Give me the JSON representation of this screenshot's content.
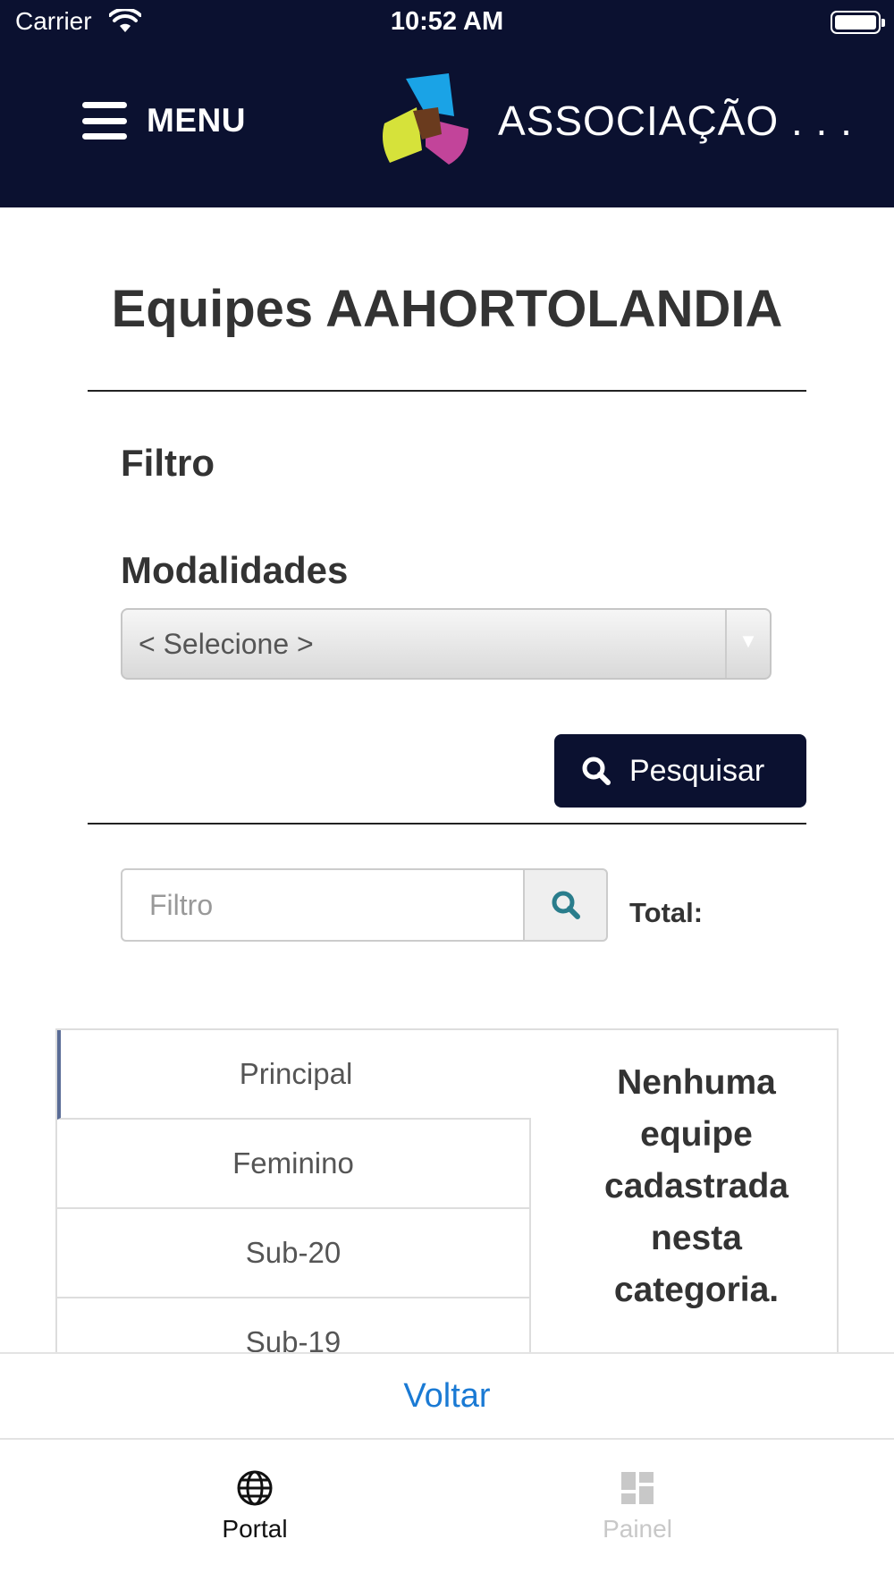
{
  "status_bar": {
    "carrier": "Carrier",
    "time": "10:52 AM"
  },
  "header": {
    "menu_label": "MENU",
    "brand": "ASSOCIAÇÃO . . ."
  },
  "page": {
    "title": "Equipes AAHORTOLANDIA"
  },
  "filter_section": {
    "heading": "Filtro",
    "modalidades_label": "Modalidades",
    "modalidades_selected": "< Selecione >",
    "search_button": "Pesquisar"
  },
  "list_filter": {
    "placeholder": "Filtro",
    "total_label": "Total:"
  },
  "categories": [
    {
      "label": "Principal"
    },
    {
      "label": "Feminino"
    },
    {
      "label": "Sub-20"
    },
    {
      "label": "Sub-19"
    }
  ],
  "empty_message": "Nenhuma equipe cadastrada nesta categoria.",
  "back": {
    "label": "Voltar"
  },
  "tabbar": {
    "portal": "Portal",
    "painel": "Painel"
  },
  "colors": {
    "header_bg": "#0b1130",
    "link": "#1a7ad4",
    "active_tab_accent": "#5a6c96",
    "search_icon": "#2a7d8c"
  }
}
